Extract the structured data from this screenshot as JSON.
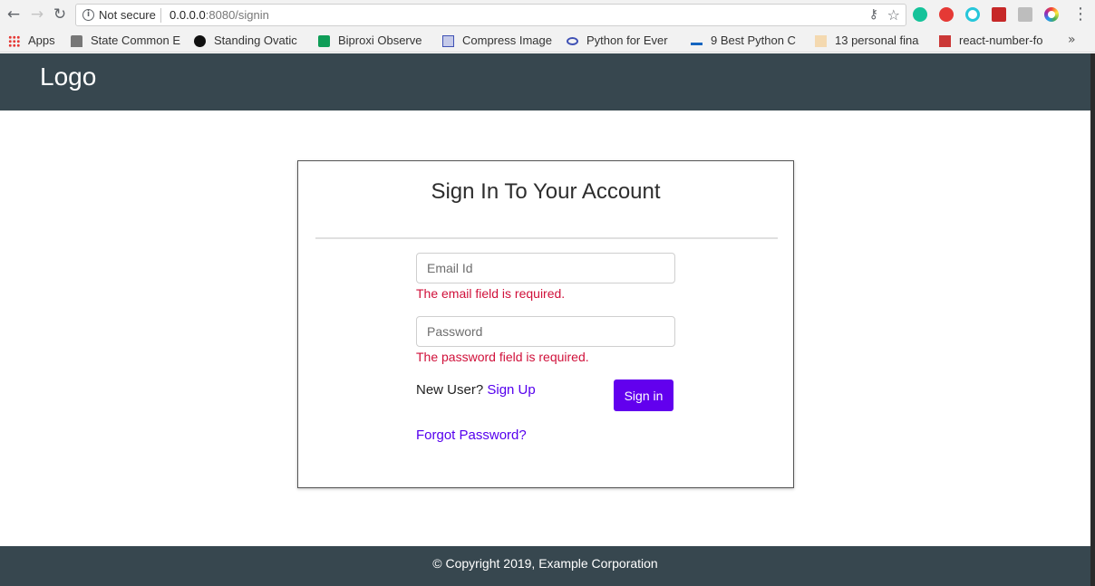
{
  "browser": {
    "security_label": "Not secure",
    "url_host": "0.0.0.0",
    "url_path": ":8080/signin",
    "bookmarks": [
      {
        "label": "Apps",
        "icon": "apps-grid-icon",
        "color": "#e53935"
      },
      {
        "label": "State Common E",
        "icon": "emblem-icon",
        "color": "#555555"
      },
      {
        "label": "Standing Ovatic",
        "icon": "b-circle-icon",
        "color": "#111111"
      },
      {
        "label": "Biproxi Observe",
        "icon": "plus-square-icon",
        "color": "#0f9d58"
      },
      {
        "label": "Compress Image",
        "icon": "image-icon",
        "color": "#3f51b5"
      },
      {
        "label": "Python for Ever",
        "icon": "infinity-icon",
        "color": "#3f51b5"
      },
      {
        "label": "9 Best Python C",
        "icon": "dd-icon",
        "color": "#1565c0"
      },
      {
        "label": "13 personal fina",
        "icon": "ft-icon",
        "color": "#f4d9b0"
      },
      {
        "label": "react-number-fo",
        "icon": "npm-icon",
        "color": "#cb3837"
      }
    ],
    "more_label": "»"
  },
  "header": {
    "logo": "Logo",
    "background": "#37474f"
  },
  "signin": {
    "title": "Sign In To Your Account",
    "email_placeholder": "Email Id",
    "email_error": "The email field is required.",
    "password_placeholder": "Password",
    "password_error": "The password field is required.",
    "new_user_prefix": "New User?",
    "signup_link": "Sign Up",
    "signin_button": "Sign in",
    "forgot_link": "Forgot Password?",
    "accent_color": "#6200ee",
    "error_color": "#d0103a"
  },
  "footer": {
    "text": "© Copyright 2019, Example Corporation"
  }
}
